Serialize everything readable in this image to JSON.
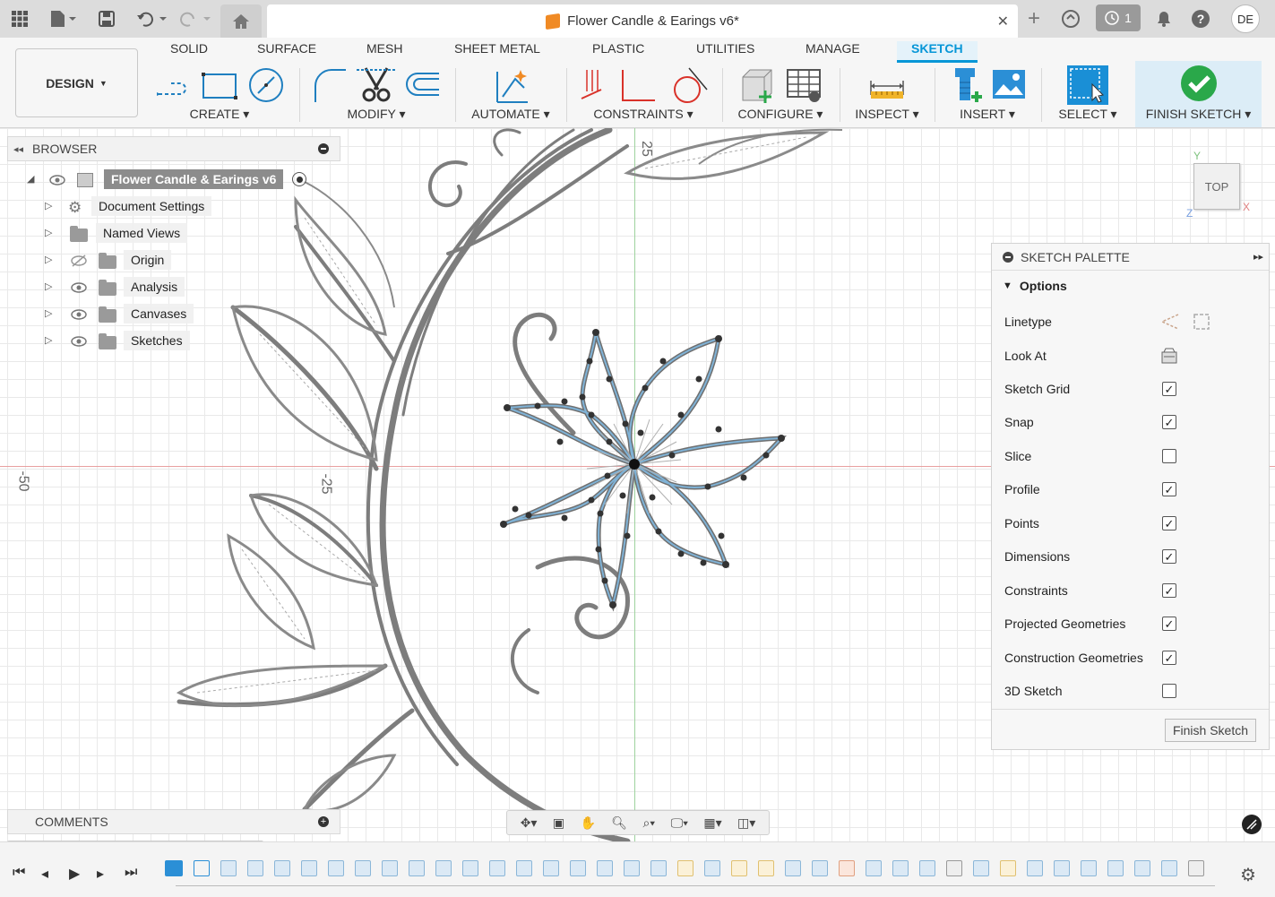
{
  "window": {
    "title": "Flower Candle & Earings v6*",
    "job_count": "1",
    "user_initials": "DE"
  },
  "workspace": {
    "label": "DESIGN"
  },
  "ribbon_tabs": [
    "SOLID",
    "SURFACE",
    "MESH",
    "SHEET METAL",
    "PLASTIC",
    "UTILITIES",
    "MANAGE",
    "SKETCH"
  ],
  "active_tab": "SKETCH",
  "groups": {
    "create": "CREATE",
    "modify": "MODIFY",
    "automate": "AUTOMATE",
    "constraints": "CONSTRAINTS",
    "configure": "CONFIGURE",
    "inspect": "INSPECT",
    "insert": "INSERT",
    "select": "SELECT",
    "finish": "FINISH SKETCH"
  },
  "browser": {
    "title": "BROWSER",
    "root": "Flower Candle & Earings v6",
    "items": [
      "Document Settings",
      "Named Views",
      "Origin",
      "Analysis",
      "Canvases",
      "Sketches"
    ]
  },
  "palette": {
    "title": "SKETCH PALETTE",
    "section": "Options",
    "rows": [
      {
        "name": "Linetype",
        "type": "icons"
      },
      {
        "name": "Look At",
        "type": "icon"
      },
      {
        "name": "Sketch Grid",
        "checked": true
      },
      {
        "name": "Snap",
        "checked": true
      },
      {
        "name": "Slice",
        "checked": false
      },
      {
        "name": "Profile",
        "checked": true
      },
      {
        "name": "Points",
        "checked": true
      },
      {
        "name": "Dimensions",
        "checked": true
      },
      {
        "name": "Constraints",
        "checked": true
      },
      {
        "name": "Projected Geometries",
        "checked": true
      },
      {
        "name": "Construction Geometries",
        "checked": true
      },
      {
        "name": "3D Sketch",
        "checked": false
      }
    ],
    "finish_button": "Finish Sketch"
  },
  "viewcube": {
    "face": "TOP",
    "y": "Y",
    "x": "X",
    "z": "Z"
  },
  "axis_labels": {
    "left": "-50",
    "mid": "-25",
    "top": "25"
  },
  "comments": {
    "title": "COMMENTS"
  },
  "colors": {
    "accent": "#0696d7",
    "finish_green": "#2aa84a",
    "sketch_curve": "#7fb2d6",
    "axis_red": "#e08080",
    "axis_green": "#7ec27e"
  }
}
